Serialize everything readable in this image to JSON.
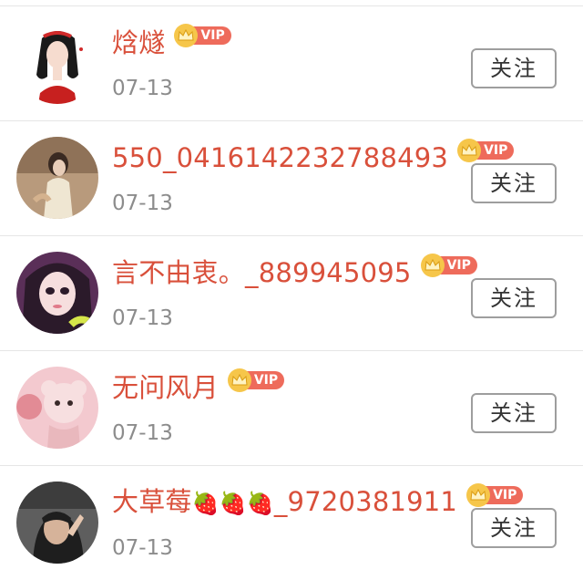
{
  "follow_label": "关注",
  "vip_label": "VIP",
  "users": [
    {
      "name": "焓燧",
      "date": "07-13",
      "vip": true
    },
    {
      "name": "550_0416142232788493",
      "date": "07-13",
      "vip": true
    },
    {
      "name": "言不由衷。_889945095",
      "date": "07-13",
      "vip": true
    },
    {
      "name": "无问风月",
      "date": "07-13",
      "vip": true
    },
    {
      "name_prefix": "大草莓",
      "name_emoji": "🍓🍓🍓",
      "name_suffix": "_9720381911",
      "date": "07-13",
      "vip": true
    }
  ],
  "colors": {
    "name": "#d9503b",
    "date": "#8c8c8c",
    "vip_badge": "#ee6b5b",
    "vip_crown": "#f6c64a",
    "button_border": "#9e9e9e"
  }
}
